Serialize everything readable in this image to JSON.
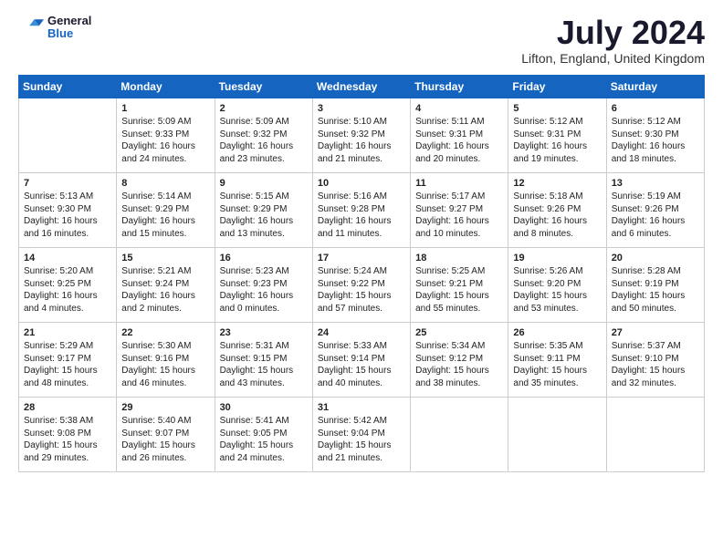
{
  "logo": {
    "general": "General",
    "blue": "Blue"
  },
  "title": "July 2024",
  "location": "Lifton, England, United Kingdom",
  "days_header": [
    "Sunday",
    "Monday",
    "Tuesday",
    "Wednesday",
    "Thursday",
    "Friday",
    "Saturday"
  ],
  "weeks": [
    [
      {
        "day": "",
        "info": ""
      },
      {
        "day": "1",
        "info": "Sunrise: 5:09 AM\nSunset: 9:33 PM\nDaylight: 16 hours\nand 24 minutes."
      },
      {
        "day": "2",
        "info": "Sunrise: 5:09 AM\nSunset: 9:32 PM\nDaylight: 16 hours\nand 23 minutes."
      },
      {
        "day": "3",
        "info": "Sunrise: 5:10 AM\nSunset: 9:32 PM\nDaylight: 16 hours\nand 21 minutes."
      },
      {
        "day": "4",
        "info": "Sunrise: 5:11 AM\nSunset: 9:31 PM\nDaylight: 16 hours\nand 20 minutes."
      },
      {
        "day": "5",
        "info": "Sunrise: 5:12 AM\nSunset: 9:31 PM\nDaylight: 16 hours\nand 19 minutes."
      },
      {
        "day": "6",
        "info": "Sunrise: 5:12 AM\nSunset: 9:30 PM\nDaylight: 16 hours\nand 18 minutes."
      }
    ],
    [
      {
        "day": "7",
        "info": "Sunrise: 5:13 AM\nSunset: 9:30 PM\nDaylight: 16 hours\nand 16 minutes."
      },
      {
        "day": "8",
        "info": "Sunrise: 5:14 AM\nSunset: 9:29 PM\nDaylight: 16 hours\nand 15 minutes."
      },
      {
        "day": "9",
        "info": "Sunrise: 5:15 AM\nSunset: 9:29 PM\nDaylight: 16 hours\nand 13 minutes."
      },
      {
        "day": "10",
        "info": "Sunrise: 5:16 AM\nSunset: 9:28 PM\nDaylight: 16 hours\nand 11 minutes."
      },
      {
        "day": "11",
        "info": "Sunrise: 5:17 AM\nSunset: 9:27 PM\nDaylight: 16 hours\nand 10 minutes."
      },
      {
        "day": "12",
        "info": "Sunrise: 5:18 AM\nSunset: 9:26 PM\nDaylight: 16 hours\nand 8 minutes."
      },
      {
        "day": "13",
        "info": "Sunrise: 5:19 AM\nSunset: 9:26 PM\nDaylight: 16 hours\nand 6 minutes."
      }
    ],
    [
      {
        "day": "14",
        "info": "Sunrise: 5:20 AM\nSunset: 9:25 PM\nDaylight: 16 hours\nand 4 minutes."
      },
      {
        "day": "15",
        "info": "Sunrise: 5:21 AM\nSunset: 9:24 PM\nDaylight: 16 hours\nand 2 minutes."
      },
      {
        "day": "16",
        "info": "Sunrise: 5:23 AM\nSunset: 9:23 PM\nDaylight: 16 hours\nand 0 minutes."
      },
      {
        "day": "17",
        "info": "Sunrise: 5:24 AM\nSunset: 9:22 PM\nDaylight: 15 hours\nand 57 minutes."
      },
      {
        "day": "18",
        "info": "Sunrise: 5:25 AM\nSunset: 9:21 PM\nDaylight: 15 hours\nand 55 minutes."
      },
      {
        "day": "19",
        "info": "Sunrise: 5:26 AM\nSunset: 9:20 PM\nDaylight: 15 hours\nand 53 minutes."
      },
      {
        "day": "20",
        "info": "Sunrise: 5:28 AM\nSunset: 9:19 PM\nDaylight: 15 hours\nand 50 minutes."
      }
    ],
    [
      {
        "day": "21",
        "info": "Sunrise: 5:29 AM\nSunset: 9:17 PM\nDaylight: 15 hours\nand 48 minutes."
      },
      {
        "day": "22",
        "info": "Sunrise: 5:30 AM\nSunset: 9:16 PM\nDaylight: 15 hours\nand 46 minutes."
      },
      {
        "day": "23",
        "info": "Sunrise: 5:31 AM\nSunset: 9:15 PM\nDaylight: 15 hours\nand 43 minutes."
      },
      {
        "day": "24",
        "info": "Sunrise: 5:33 AM\nSunset: 9:14 PM\nDaylight: 15 hours\nand 40 minutes."
      },
      {
        "day": "25",
        "info": "Sunrise: 5:34 AM\nSunset: 9:12 PM\nDaylight: 15 hours\nand 38 minutes."
      },
      {
        "day": "26",
        "info": "Sunrise: 5:35 AM\nSunset: 9:11 PM\nDaylight: 15 hours\nand 35 minutes."
      },
      {
        "day": "27",
        "info": "Sunrise: 5:37 AM\nSunset: 9:10 PM\nDaylight: 15 hours\nand 32 minutes."
      }
    ],
    [
      {
        "day": "28",
        "info": "Sunrise: 5:38 AM\nSunset: 9:08 PM\nDaylight: 15 hours\nand 29 minutes."
      },
      {
        "day": "29",
        "info": "Sunrise: 5:40 AM\nSunset: 9:07 PM\nDaylight: 15 hours\nand 26 minutes."
      },
      {
        "day": "30",
        "info": "Sunrise: 5:41 AM\nSunset: 9:05 PM\nDaylight: 15 hours\nand 24 minutes."
      },
      {
        "day": "31",
        "info": "Sunrise: 5:42 AM\nSunset: 9:04 PM\nDaylight: 15 hours\nand 21 minutes."
      },
      {
        "day": "",
        "info": ""
      },
      {
        "day": "",
        "info": ""
      },
      {
        "day": "",
        "info": ""
      }
    ]
  ]
}
